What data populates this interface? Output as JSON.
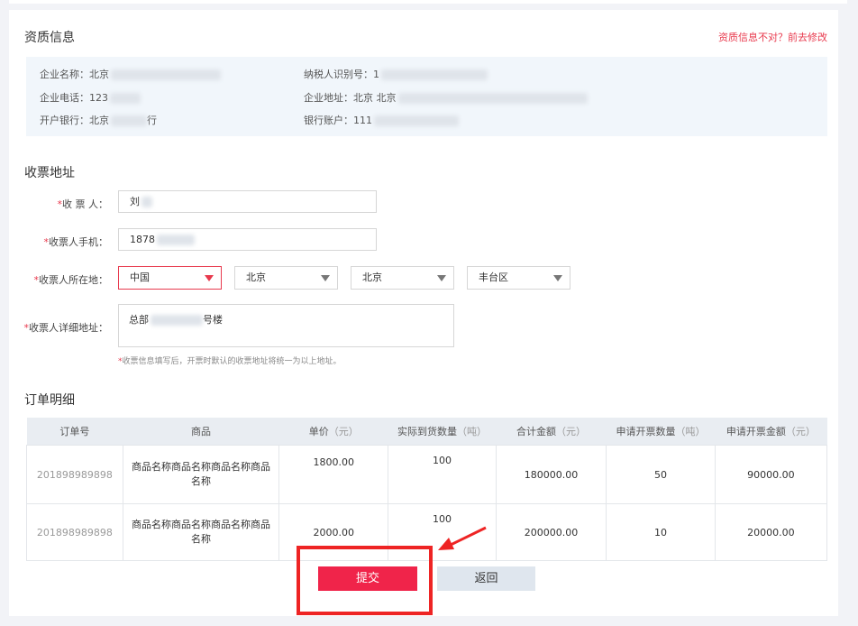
{
  "qualification": {
    "title": "资质信息",
    "edit_link": "资质信息不对？前去修改",
    "company_name_label": "企业名称：",
    "company_name_value": "北京",
    "tax_id_label": "纳税人识别号：",
    "tax_id_value": "1",
    "phone_label": "企业电话：",
    "phone_value": "123",
    "address_label": "企业地址：",
    "address_value": "北京 北京",
    "bank_label": "开户银行：",
    "bank_value": "北京",
    "bank_value_suffix": "行",
    "account_label": "银行账户：",
    "account_value": "111"
  },
  "receiver": {
    "title": "收票地址",
    "name_label": "收 票 人：",
    "name_value": "刘",
    "phone_label": "收票人手机：",
    "phone_value": "1878",
    "region_label": "收票人所在地：",
    "country": "中国",
    "province": "北京",
    "city": "北京",
    "district": "丰台区",
    "detail_label": "收票人详细地址：",
    "detail_value": "总部",
    "detail_value_suffix": "号楼",
    "hint": "收票信息填写后，开票时默认的收票地址将统一为以上地址。"
  },
  "orders": {
    "title": "订单明细",
    "headers": {
      "order_no": "订单号",
      "product": "商品",
      "unit_price": "单价",
      "unit_price_unit": "（元）",
      "delivered_qty": "实际到货数量",
      "delivered_qty_unit": "（吨）",
      "total": "合计金额",
      "total_unit": "（元）",
      "apply_qty": "申请开票数量",
      "apply_qty_unit": "（吨）",
      "apply_amount": "申请开票金额",
      "apply_amount_unit": "（元）"
    },
    "rows": [
      {
        "order_no": "201898989898",
        "product": "商品名称商品名称商品名称商品名称",
        "unit_price": "1800.00",
        "delivered_qty": "100",
        "total": "180000.00",
        "apply_qty": "50",
        "apply_amount": "90000.00"
      },
      {
        "order_no": "201898989898",
        "product": "商品名称商品名称商品名称商品名称",
        "unit_price": "2000.00",
        "delivered_qty": "100",
        "total": "200000.00",
        "apply_qty": "10",
        "apply_amount": "20000.00"
      }
    ]
  },
  "actions": {
    "submit": "提交",
    "back": "返回"
  },
  "colors": {
    "accent": "#f0244a",
    "highlight": "#ee2424"
  }
}
